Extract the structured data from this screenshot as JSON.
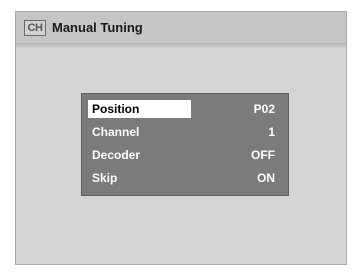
{
  "header": {
    "icon_text": "CH",
    "title": "Manual Tuning"
  },
  "menu": {
    "items": [
      {
        "label": "Position",
        "value": "P02",
        "selected": true
      },
      {
        "label": "Channel",
        "value": "1",
        "selected": false
      },
      {
        "label": "Decoder",
        "value": "OFF",
        "selected": false
      },
      {
        "label": "Skip",
        "value": "ON",
        "selected": false
      }
    ]
  }
}
